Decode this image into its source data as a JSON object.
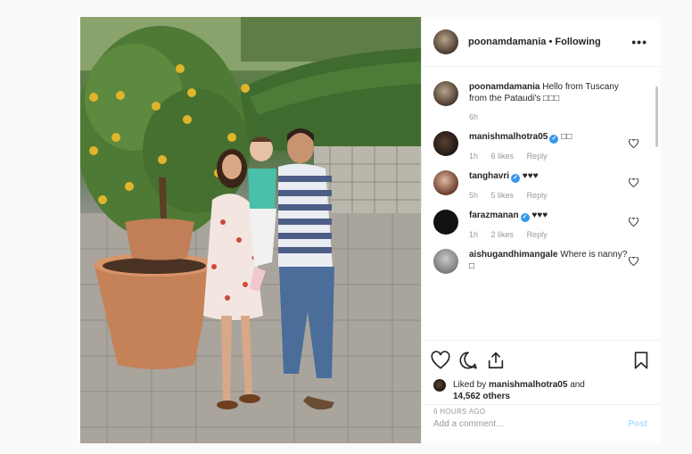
{
  "post": {
    "username": "poonamdamania",
    "separator": "•",
    "follow_state": "Following",
    "more_label": "•••"
  },
  "caption": {
    "username": "poonamdamania",
    "text": "Hello from Tuscany from the Pataudi's □□□",
    "age": "6h"
  },
  "comments": [
    {
      "username": "manishmalhotra05",
      "verified": true,
      "text": "□□",
      "age": "1h",
      "likes": "6 likes",
      "reply": "Reply"
    },
    {
      "username": "tanghavri",
      "verified": true,
      "text": "♥♥♥",
      "age": "5h",
      "likes": "5 likes",
      "reply": "Reply"
    },
    {
      "username": "farazmanan",
      "verified": true,
      "text": "♥♥♥",
      "age": "1h",
      "likes": "2 likes",
      "reply": "Reply"
    },
    {
      "username": "aishugandhimangale",
      "verified": false,
      "text": "Where is nanny? □",
      "age": "",
      "likes": "",
      "reply": ""
    }
  ],
  "likes": {
    "prefix": "Liked by",
    "user": "manishmalhotra05",
    "and": "and",
    "count": "14,562 others"
  },
  "timestamp": "6 HOURS AGO",
  "add_comment": {
    "placeholder": "Add a comment...",
    "post_label": "Post"
  },
  "icons": {
    "like": "heart-icon",
    "comment": "comment-icon",
    "share": "share-icon",
    "save": "bookmark-icon"
  }
}
